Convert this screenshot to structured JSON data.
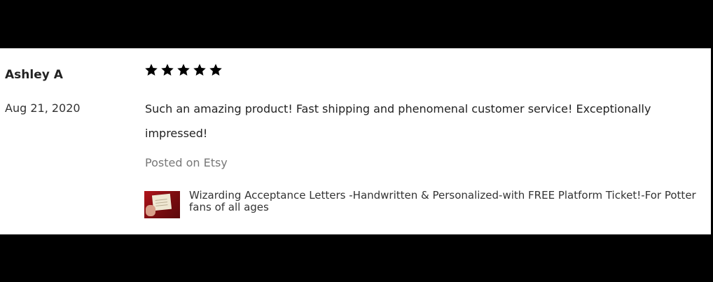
{
  "review": {
    "reviewer_name": "Ashley A",
    "date": "Aug 21, 2020",
    "rating": 5,
    "rating_max": 5,
    "text": "Such an amazing product! Fast shipping and phenomenal customer service! Exceptionally impressed!",
    "source": "Posted on Etsy"
  },
  "product": {
    "title": "Wizarding Acceptance Letters -Handwritten & Personalized-with FREE Platform Ticket!-For Potter fans of all ages",
    "thumbnail_icon": "product-thumbnail"
  },
  "colors": {
    "background_bars": "#000000",
    "card": "#ffffff",
    "star": "#000000",
    "muted_text": "#777777"
  }
}
